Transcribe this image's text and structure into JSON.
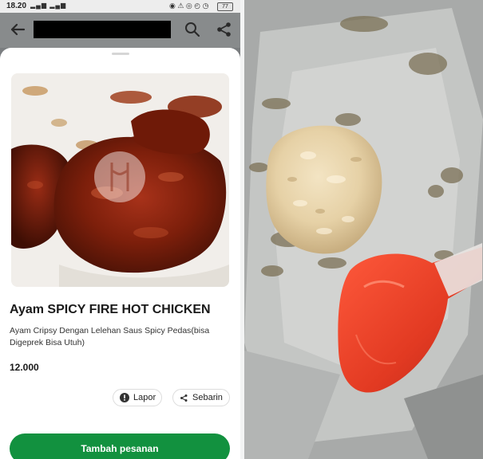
{
  "status_bar": {
    "time": "18.20",
    "battery": "77"
  },
  "app_bar": {
    "back_icon": "arrow-left-icon",
    "search_icon": "search-icon",
    "share_icon": "share-icon"
  },
  "product": {
    "title": "Ayam SPICY FIRE HOT CHICKEN",
    "description": "Ayam Cripsy Dengan Lelehan Saus Spicy Pedas(bisa Digeprek Bisa Utuh)",
    "price": "12.000"
  },
  "actions": {
    "report_label": "Lapor",
    "share_label": "Sebarin",
    "add_order_label": "Tambah pesanan"
  },
  "colors": {
    "primary_green": "#12913f",
    "sauce_red": "#8e1f0a"
  }
}
